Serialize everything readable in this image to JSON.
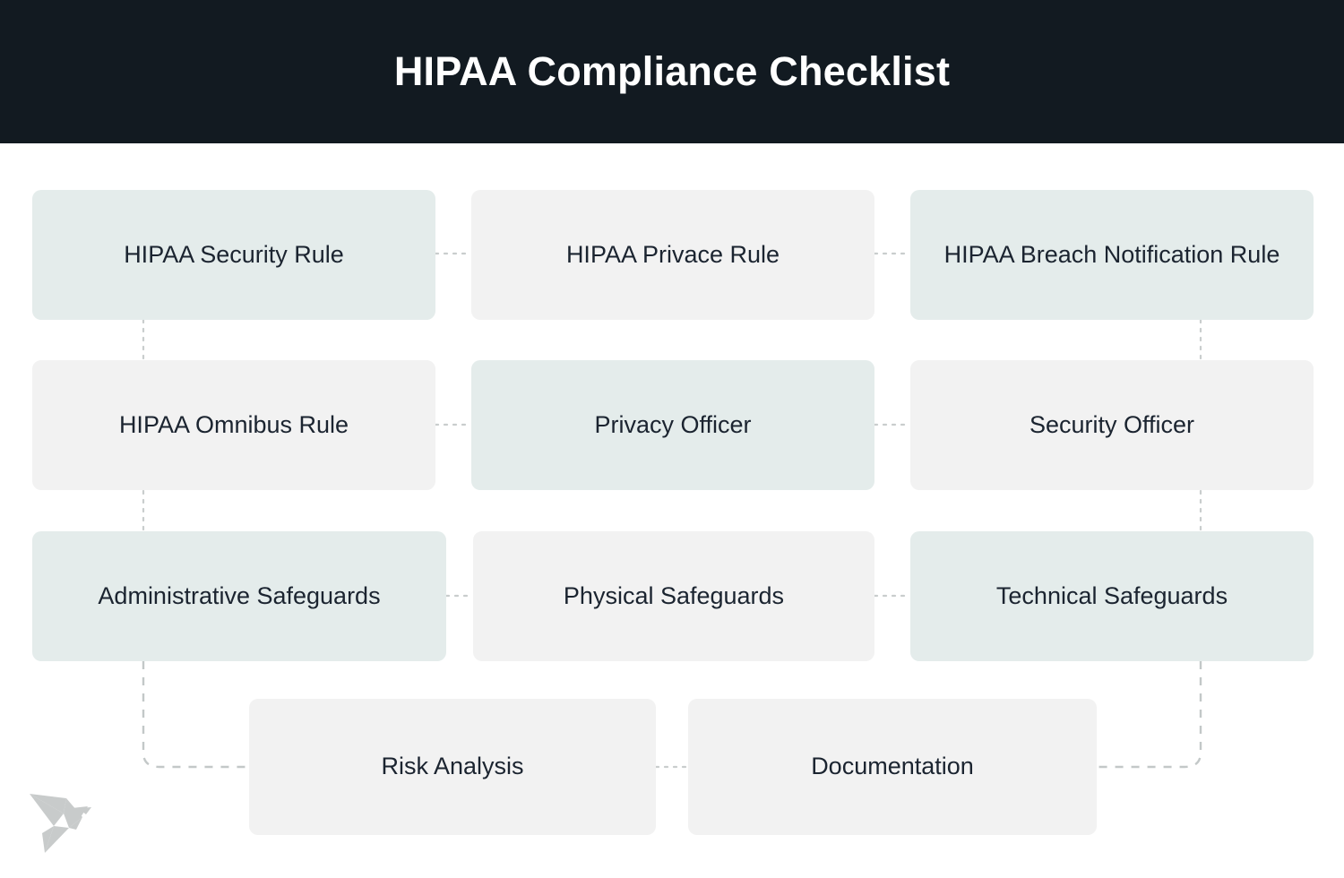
{
  "header": {
    "title": "HIPAA Compliance Checklist",
    "background_color": "#121a21",
    "text_color": "#ffffff"
  },
  "theme": {
    "page_background": "#ffffff",
    "node_teal": "#e4eceb",
    "node_grey": "#f2f2f2",
    "node_text": "#1b2430",
    "connector_color": "#c9cdcd",
    "logo_color": "#c8cbcb"
  },
  "diagram": {
    "type": "flowchart-grid",
    "rows": 4,
    "columns": 3,
    "nodes": [
      {
        "id": "hipaa-security-rule",
        "label": "HIPAA Security Rule",
        "style": "teal",
        "row": 1,
        "col": 1
      },
      {
        "id": "hipaa-privace-rule",
        "label": "HIPAA Privace Rule",
        "style": "grey",
        "row": 1,
        "col": 2
      },
      {
        "id": "hipaa-breach-notification-rule",
        "label": "HIPAA Breach Notification Rule",
        "style": "teal",
        "row": 1,
        "col": 3
      },
      {
        "id": "hipaa-omnibus-rule",
        "label": "HIPAA Omnibus Rule",
        "style": "grey",
        "row": 2,
        "col": 1
      },
      {
        "id": "privacy-officer",
        "label": "Privacy Officer",
        "style": "teal",
        "row": 2,
        "col": 2
      },
      {
        "id": "security-officer",
        "label": "Security Officer",
        "style": "grey",
        "row": 2,
        "col": 3
      },
      {
        "id": "administrative-safeguards",
        "label": "Administrative Safeguards",
        "style": "teal",
        "row": 3,
        "col": 1
      },
      {
        "id": "physical-safeguards",
        "label": "Physical Safeguards",
        "style": "grey",
        "row": 3,
        "col": 2
      },
      {
        "id": "technical-safeguards",
        "label": "Technical Safeguards",
        "style": "teal",
        "row": 3,
        "col": 3
      },
      {
        "id": "risk-analysis",
        "label": "Risk Analysis",
        "style": "grey",
        "row": 4,
        "col": 1
      },
      {
        "id": "documentation",
        "label": "Documentation",
        "style": "grey",
        "row": 4,
        "col": 2
      }
    ],
    "connections": [
      {
        "from": "hipaa-security-rule",
        "to": "hipaa-privace-rule",
        "kind": "horizontal-dotted"
      },
      {
        "from": "hipaa-privace-rule",
        "to": "hipaa-breach-notification-rule",
        "kind": "horizontal-dotted"
      },
      {
        "from": "hipaa-security-rule",
        "to": "hipaa-omnibus-rule",
        "kind": "vertical-dotted"
      },
      {
        "from": "hipaa-breach-notification-rule",
        "to": "security-officer",
        "kind": "vertical-dotted"
      },
      {
        "from": "hipaa-omnibus-rule",
        "to": "privacy-officer",
        "kind": "horizontal-dotted"
      },
      {
        "from": "privacy-officer",
        "to": "security-officer",
        "kind": "horizontal-dotted"
      },
      {
        "from": "hipaa-omnibus-rule",
        "to": "administrative-safeguards",
        "kind": "vertical-dotted"
      },
      {
        "from": "security-officer",
        "to": "technical-safeguards",
        "kind": "vertical-dotted"
      },
      {
        "from": "administrative-safeguards",
        "to": "physical-safeguards",
        "kind": "horizontal-dotted"
      },
      {
        "from": "physical-safeguards",
        "to": "technical-safeguards",
        "kind": "horizontal-dotted"
      },
      {
        "from": "administrative-safeguards",
        "to": "risk-analysis",
        "kind": "elbow-down-right"
      },
      {
        "from": "risk-analysis",
        "to": "documentation",
        "kind": "horizontal-dotted"
      },
      {
        "from": "technical-safeguards",
        "to": "documentation",
        "kind": "elbow-down-left"
      }
    ]
  },
  "logo": {
    "name": "origami-bird-logo"
  }
}
